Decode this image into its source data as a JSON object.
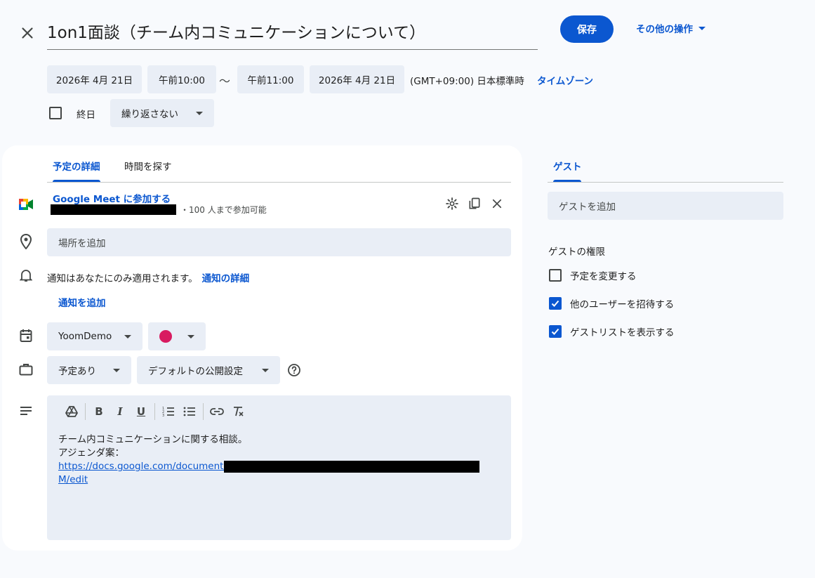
{
  "header": {
    "title": "1on1面談（チーム内コミュニケーションについて）",
    "save_label": "保存",
    "more_actions_label": "その他の操作"
  },
  "datetime": {
    "start_date": "2026年 4月 21日",
    "start_time": "午前10:00",
    "separator": "～",
    "end_time": "午前11:00",
    "end_date": "2026年 4月 21日",
    "timezone_text": "(GMT+09:00) 日本標準時",
    "timezone_link": "タイムゾーン",
    "all_day_label": "終日",
    "all_day_checked": false,
    "repeat_value": "繰り返さない"
  },
  "tabs": {
    "details": "予定の詳細",
    "find_time": "時間を探す",
    "active": "details"
  },
  "meet": {
    "join_label": "Google Meet に参加する",
    "capacity_text": "・100 人まで参加可能"
  },
  "location": {
    "placeholder": "場所を追加"
  },
  "notifications": {
    "info_text": "通知はあなたにのみ適用されます。",
    "details_link": "通知の詳細",
    "add_label": "通知を追加"
  },
  "calendar": {
    "name": "YoomDemo",
    "color": "#d81b60"
  },
  "availability": {
    "busy_value": "予定あり",
    "visibility_value": "デフォルトの公開設定"
  },
  "description": {
    "line1": "チーム内コミュニケーションに関する相談。",
    "line2": "アジェンダ案：",
    "link_prefix": "https://docs.google.com/document/d/",
    "link_suffix": "M/edit"
  },
  "guests": {
    "tab_label": "ゲスト",
    "add_placeholder": "ゲストを追加",
    "permissions_title": "ゲストの権限",
    "permissions": [
      {
        "label": "予定を変更する",
        "checked": false
      },
      {
        "label": "他のユーザーを招待する",
        "checked": true
      },
      {
        "label": "ゲストリストを表示する",
        "checked": true
      }
    ]
  },
  "colors": {
    "accent": "#0b57d0",
    "chip_bg": "#e9eef6",
    "page_bg": "#f8fafd"
  }
}
